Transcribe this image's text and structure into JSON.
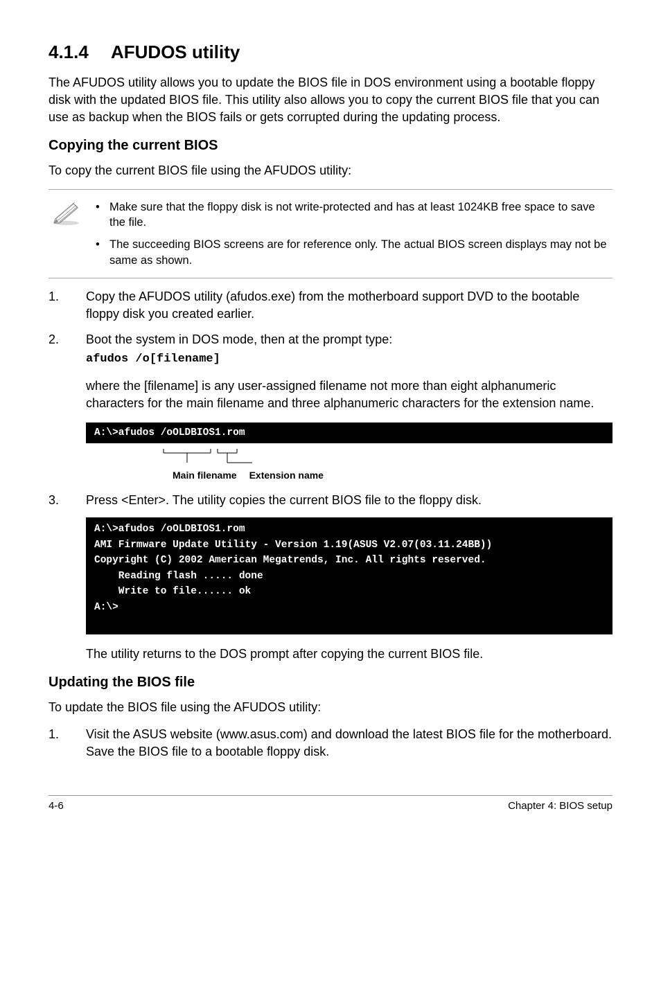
{
  "heading": {
    "num": "4.1.4",
    "title": "AFUDOS utility"
  },
  "intro": "The AFUDOS utility allows you to update the BIOS file in DOS environment using a bootable floppy disk with the updated BIOS file. This utility also allows you to copy the current BIOS file that you can use as backup when the BIOS fails or gets corrupted during the updating process.",
  "copying": {
    "heading": "Copying the current BIOS",
    "lead": "To copy the current BIOS file using the AFUDOS utility:",
    "notes": [
      "Make sure that the floppy disk is not write-protected and has at least 1024KB free space to save the file.",
      "The succeeding BIOS screens are for reference only. The actual BIOS screen displays may not be same as shown."
    ],
    "steps": {
      "s1": "Copy the AFUDOS utility (afudos.exe) from the motherboard support DVD to the bootable floppy disk you created earlier.",
      "s2": "Boot the system in DOS mode, then at the prompt type:",
      "s2_code": "afudos /o[filename]",
      "s2_sub": "where the [filename] is any user-assigned filename not more than eight alphanumeric characters  for the main filename and three alphanumeric characters for the extension name.",
      "s3": "Press <Enter>. The utility copies the current BIOS file to the floppy disk."
    },
    "terminal1_line": "A:\\>afudos /oOLDBIOS1.rom",
    "diagram_labels": {
      "main": "Main filename",
      "ext": "Extension name"
    },
    "terminal2": "A:\\>afudos /oOLDBIOS1.rom\nAMI Firmware Update Utility - Version 1.19(ASUS V2.07(03.11.24BB))\nCopyright (C) 2002 American Megatrends, Inc. All rights reserved.\n    Reading flash ..... done\n    Write to file...... ok\nA:\\>\n ",
    "after_terminal2": "The utility returns to the DOS prompt after copying the current BIOS file."
  },
  "updating": {
    "heading": "Updating the BIOS file",
    "lead": "To update the BIOS file using the AFUDOS utility:",
    "steps": {
      "s1": "Visit the ASUS website (www.asus.com) and download the latest BIOS file for the motherboard. Save the BIOS file to a bootable floppy disk."
    }
  },
  "footer": {
    "left": "4-6",
    "right": "Chapter 4: BIOS setup"
  }
}
